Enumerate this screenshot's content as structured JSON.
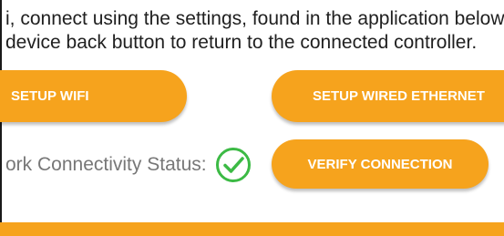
{
  "instructions": {
    "line1": "i, connect using the settings, found in the application below. Wh",
    "line2": "device back button to return to the connected controller."
  },
  "buttons": {
    "setup_wifi": "SETUP WIFI",
    "setup_wired_ethernet": "SETUP WIRED ETHERNET",
    "verify_connection": "VERIFY CONNECTION"
  },
  "status": {
    "label": "ork Connectivity Status:",
    "icon": "check-circle-icon",
    "icon_color": "#3cba45"
  },
  "colors": {
    "accent": "#f6a31d",
    "text": "#1f1f1f",
    "muted_text": "#777777"
  }
}
